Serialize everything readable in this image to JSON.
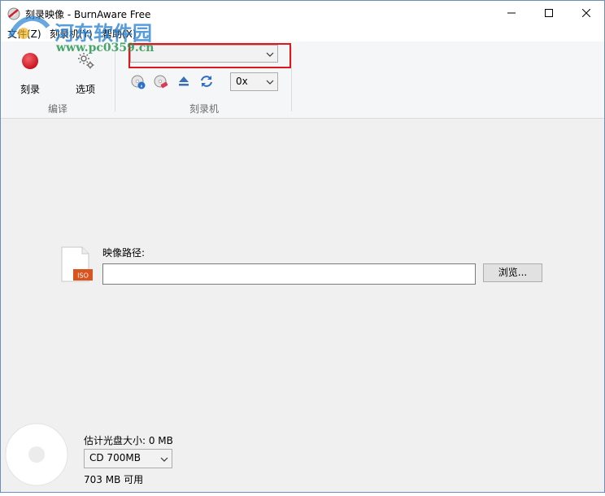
{
  "window": {
    "title": "刻录映像 - BurnAware Free",
    "accent": "#e0181b"
  },
  "menu": [
    {
      "label": "文件(Z)"
    },
    {
      "label": "刻录机(Y)"
    },
    {
      "label": "帮助(X)"
    }
  ],
  "ribbon": {
    "burn_label": "刻录",
    "options_label": "选项",
    "group_edit": "编译",
    "group_burner": "刻录机",
    "drive_select_value": "",
    "speed_value": "0x",
    "icons": [
      "disc-info-icon",
      "erase-disc-icon",
      "eject-icon",
      "refresh-icon"
    ]
  },
  "main": {
    "path_label": "映像路径:",
    "path_value": "",
    "browse_label": "浏览...",
    "file_badge": "ISO"
  },
  "footer": {
    "estimated_size_label": "估计光盘大小: 0 MB",
    "disc_type_value": "CD 700MB",
    "available_label": "703 MB 可用"
  },
  "watermark": {
    "line1": "河东软件园",
    "line2": "www.pc0359.cn"
  }
}
